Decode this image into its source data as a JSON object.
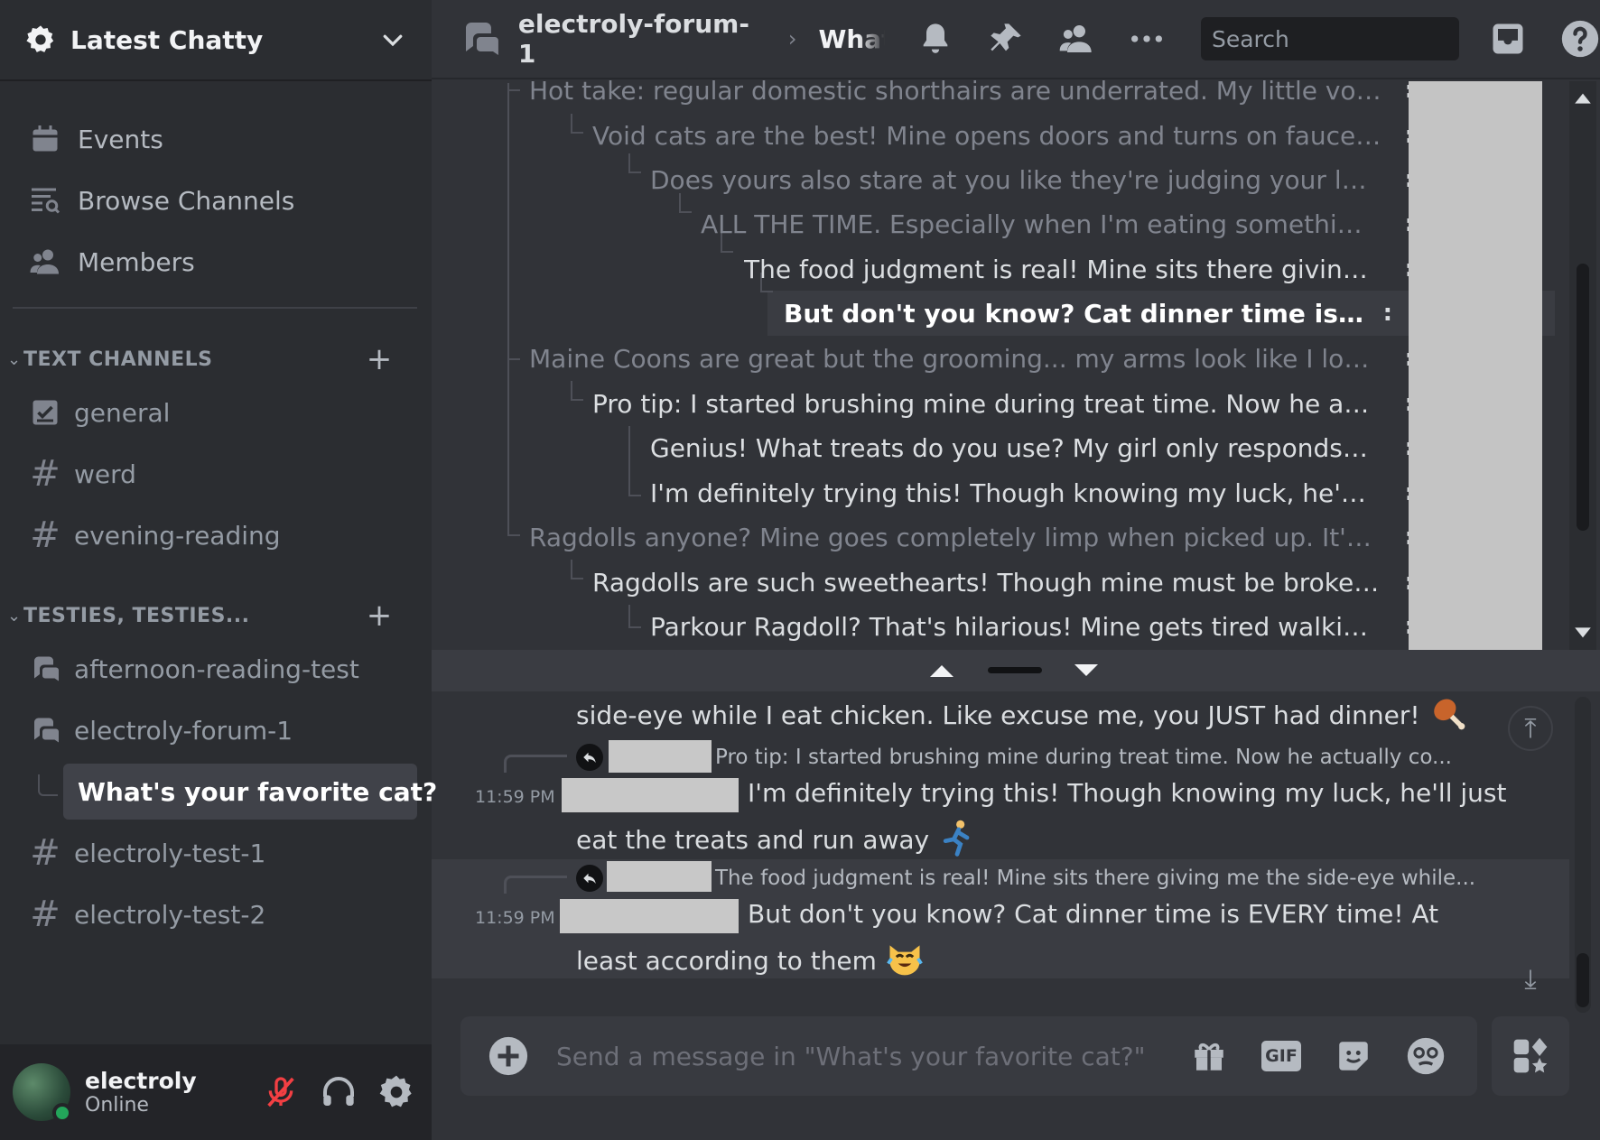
{
  "server": {
    "name": "Latest Chatty",
    "icon": "gear-icon"
  },
  "nav": [
    {
      "label": "Events",
      "icon": "calendar-icon"
    },
    {
      "label": "Browse Channels",
      "icon": "browse-channels-icon"
    },
    {
      "label": "Members",
      "icon": "members-icon"
    }
  ],
  "categories": {
    "text": "TEXT CHANNELS",
    "testies": "TESTIES, TESTIES..."
  },
  "channels": {
    "general": "general",
    "werd": "werd",
    "evening": "evening-reading",
    "afternoon": "afternoon-reading-test",
    "forum": "electroly-forum-1",
    "thread": "What's your favorite cat?",
    "test1": "electroly-test-1",
    "test2": "electroly-test-2"
  },
  "user": {
    "name": "electroly",
    "status": "Online"
  },
  "topbar": {
    "channel": "electroly-forum-1",
    "separator": "›",
    "thread": "What's your favorite cat?",
    "search_placeholder": "Search"
  },
  "tree": {
    "kebab": ":",
    "rows": [
      "Hot take: regular domestic shorthairs are underrated. My little void ...",
      "Void cats are the best! Mine opens doors and turns on faucets. ...",
      "Does yours also stare at you like they're judging your life c...",
      "ALL THE TIME. Especially when I'm eating something ...",
      "The food judgment is real! Mine sits there giving m...",
      "But don't you know? Cat dinner time is EVER...",
      "Maine Coons are great but the grooming... my arms look like I lost a ...",
      "Pro tip: I started brushing mine during treat time. Now he actu...",
      "Genius! What treats do you use? My girl only responds to t...",
      "I'm definitely trying this! Though knowing my luck, he'll jus...",
      "Ragdolls anyone? Mine goes completely limp when picked up. It's lik...",
      "Ragdolls are such sweethearts! Though mine must be broken - ...",
      "Parkour Ragdoll? That's hilarious! Mine gets tired walking f..."
    ]
  },
  "messages": {
    "cont_text": "side-eye while I eat chicken. Like excuse me, you JUST had dinner!",
    "m1": {
      "reply_preview": "Pro tip: I started brushing mine during treat time. Now he actually co...",
      "time": "11:59 PM",
      "line1": "I'm definitely trying this! Though knowing my luck, he'll just",
      "line2": "eat the treats and run away"
    },
    "m2": {
      "reply_preview": "The food judgment is real! Mine sits there giving me the side-eye while...",
      "time": "11:59 PM",
      "line1": "But don't you know? Cat dinner time is EVERY time! At",
      "line2": "least according to them"
    }
  },
  "composer": {
    "placeholder": "Send a message in \"What's your favorite cat?\"",
    "gif_label": "GIF"
  },
  "colors": {
    "bg": "#313338",
    "sidebar": "#2b2d31",
    "online": "#23a55a",
    "mute": "#f23f43"
  }
}
